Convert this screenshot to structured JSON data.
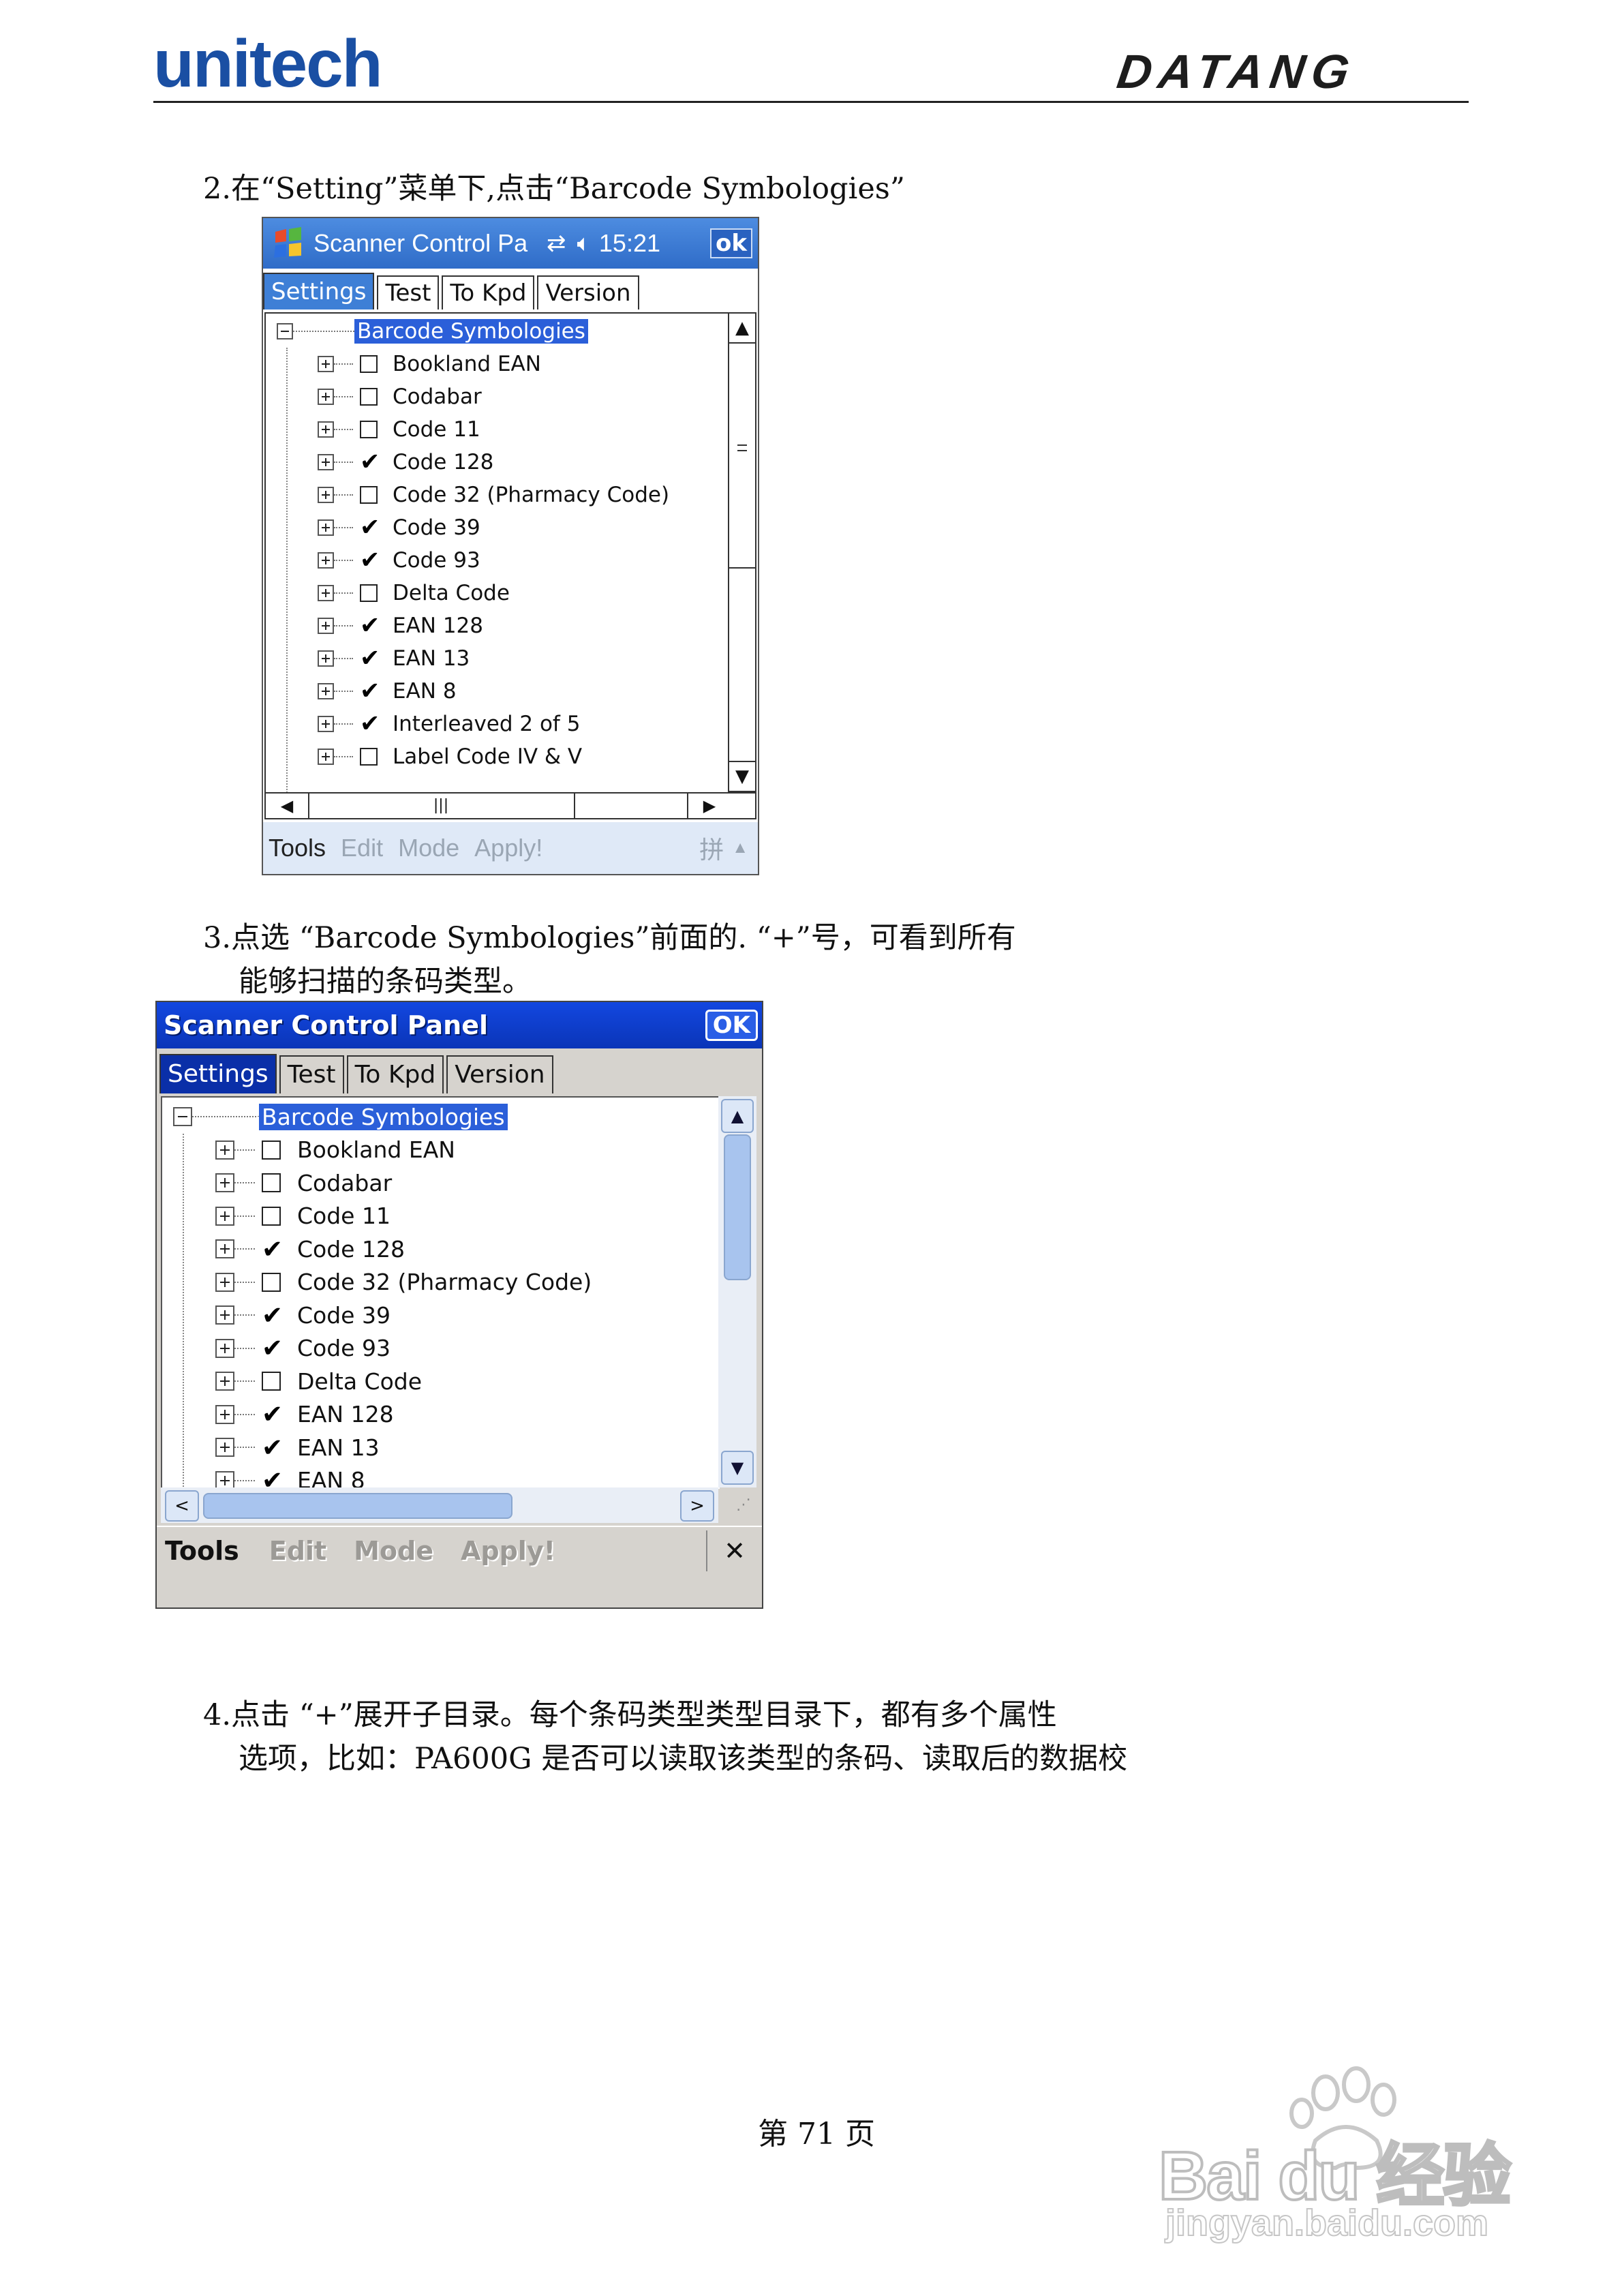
{
  "header": {
    "left_logo": "unitech",
    "right_logo": "DATANG"
  },
  "steps": [
    {
      "line1": "2.在“Setting”菜单下,点击“Barcode Symbologies”"
    },
    {
      "line1": "3.点选 “Barcode Symbologies”前面的. “+”号，可看到所有",
      "line2": "能够扫描的条码类型。"
    },
    {
      "line1": "4.点击 “+”展开子目录。每个条码类型类型目录下，都有多个属性",
      "line2": "选项，比如：PA600G 是否可以读取该类型的条码、读取后的数据校"
    }
  ],
  "screen1": {
    "title": "Scanner Control Pa",
    "time": "15:21",
    "ok_label": "ok",
    "tabs": [
      "Settings",
      "Test",
      "To Kpd",
      "Version"
    ],
    "root": "Barcode Symbologies",
    "items": [
      {
        "label": "Bookland EAN",
        "checked": false
      },
      {
        "label": "Codabar",
        "checked": false
      },
      {
        "label": "Code 11",
        "checked": false
      },
      {
        "label": "Code 128",
        "checked": true
      },
      {
        "label": "Code 32 (Pharmacy Code)",
        "checked": false
      },
      {
        "label": "Code 39",
        "checked": true
      },
      {
        "label": "Code 93",
        "checked": true
      },
      {
        "label": "Delta Code",
        "checked": false
      },
      {
        "label": "EAN 128",
        "checked": true
      },
      {
        "label": "EAN 13",
        "checked": true
      },
      {
        "label": "EAN 8",
        "checked": true
      },
      {
        "label": "Interleaved 2 of 5",
        "checked": true
      },
      {
        "label": "Label Code IV & V",
        "checked": false
      }
    ],
    "menu": [
      "Tools",
      "Edit",
      "Mode",
      "Apply!"
    ],
    "ime": "拼"
  },
  "screen2": {
    "title": "Scanner Control Panel",
    "ok_label": "OK",
    "tabs": [
      "Settings",
      "Test",
      "To Kpd",
      "Version"
    ],
    "root": "Barcode Symbologies",
    "items": [
      {
        "label": "Bookland EAN",
        "checked": false
      },
      {
        "label": "Codabar",
        "checked": false
      },
      {
        "label": "Code 11",
        "checked": false
      },
      {
        "label": "Code 128",
        "checked": true
      },
      {
        "label": "Code 32 (Pharmacy Code)",
        "checked": false
      },
      {
        "label": "Code 39",
        "checked": true
      },
      {
        "label": "Code 93",
        "checked": true
      },
      {
        "label": "Delta Code",
        "checked": false
      },
      {
        "label": "EAN 128",
        "checked": true
      },
      {
        "label": "EAN 13",
        "checked": true
      },
      {
        "label": "EAN 8",
        "checked": true
      }
    ],
    "menu": [
      "Tools",
      "Edit",
      "Mode",
      "Apply!"
    ],
    "close_label": "✕"
  },
  "footer": {
    "page": "第 71 页"
  },
  "watermark": {
    "brand": "Bai du 经验",
    "url": "jingyan.baidu.com"
  },
  "colors": {
    "brand_blue": "#1a4fa3",
    "title1_bg": "#3a7bd5",
    "title2_bg": "#0a3fd0",
    "selection": "#2b5fd9",
    "scroll_blue": "#9fc0ea"
  }
}
